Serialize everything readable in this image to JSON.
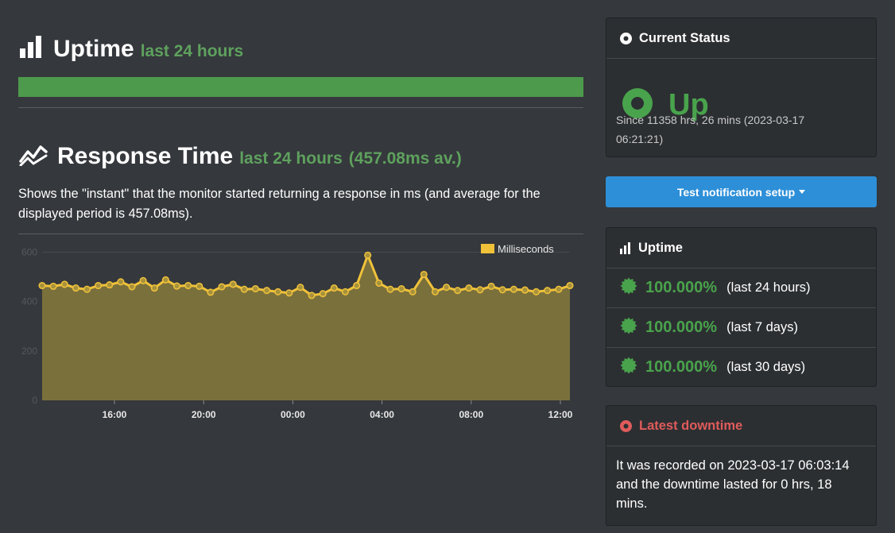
{
  "uptime_section": {
    "title": "Uptime",
    "period": "last 24 hours",
    "bar_percent": 100
  },
  "response_section": {
    "title": "Response Time",
    "period": "last 24 hours",
    "average": "(457.08ms av.)",
    "description": "Shows the \"instant\" that the monitor started returning a response in ms (and average for the displayed period is 457.08ms)."
  },
  "chart_data": {
    "type": "area",
    "legend": "Milliseconds",
    "legend_position": "top-right",
    "ylim": [
      0,
      650
    ],
    "yticks": [
      0,
      200,
      400,
      600
    ],
    "xticks": [
      "16:00",
      "20:00",
      "00:00",
      "04:00",
      "08:00",
      "12:00"
    ],
    "grid": true,
    "values": [
      465,
      462,
      470,
      455,
      450,
      465,
      468,
      480,
      460,
      485,
      455,
      488,
      463,
      465,
      462,
      438,
      460,
      470,
      450,
      452,
      445,
      440,
      435,
      458,
      425,
      432,
      455,
      440,
      465,
      588,
      475,
      450,
      452,
      440,
      510,
      440,
      458,
      445,
      455,
      448,
      462,
      448,
      450,
      447,
      440,
      445,
      450,
      465
    ],
    "color": "#f0c23a",
    "fill": "#7a703c"
  },
  "status_panel": {
    "title": "Current Status",
    "status": "Up",
    "since": "Since 11358 hrs, 26 mins (2023-03-17 06:21:21)"
  },
  "test_button": {
    "label": "Test notification setup"
  },
  "uptime_panel": {
    "title": "Uptime",
    "rows": [
      {
        "percent": "100.000%",
        "period": "(last 24 hours)"
      },
      {
        "percent": "100.000%",
        "period": "(last 7 days)"
      },
      {
        "percent": "100.000%",
        "period": "(last 30 days)"
      }
    ]
  },
  "downtime_panel": {
    "title": "Latest downtime",
    "text": "It was recorded on 2023-03-17 06:03:14 and the downtime lasted for 0 hrs, 18 mins."
  },
  "colors": {
    "accent_green": "#49a34c",
    "brand_blue": "#2d8fd8",
    "alert_red": "#e05b5b",
    "chart_line": "#f0c23a"
  }
}
